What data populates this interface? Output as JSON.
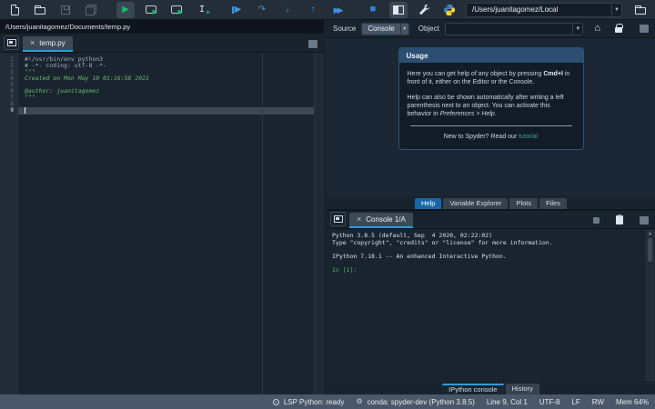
{
  "colors": {
    "accent_blue": "#2e9ce1",
    "selected_tab_blue": "#1767a8",
    "run_green": "#13bf67",
    "debug_blue": "#3f93de",
    "string_green": "#69bd6b",
    "link_teal": "#36a28c",
    "statusbar_bg": "#4b5769"
  },
  "icons": {
    "run": "▶",
    "run_cell": "▶",
    "run_selection_play": "▶",
    "ibeam": "I",
    "debug_file": "▶",
    "step_over": "↷",
    "step_into": "↓",
    "step_out": "↑",
    "continue": "▶▶",
    "stop": "■",
    "dropdown_arrow": "▼",
    "home": "⌂",
    "up_arrow": "↑",
    "close": "×",
    "gear": "⚙",
    "scroll_up": "▲"
  },
  "toolbar": {
    "working_dir_value": "/Users/juanitagomez/Local"
  },
  "editor": {
    "path": "/Users/juanitagomez/Documents/temp.py",
    "tab_label": "temp.py",
    "lines": [
      {
        "num": "1",
        "text": "#!/usr/bin/env python3"
      },
      {
        "num": "2",
        "text": "# -*- coding: utf-8 -*-"
      },
      {
        "num": "3",
        "text": "\"\"\""
      },
      {
        "num": "4",
        "text": "Created on Mon May 10 01:16:58 2021"
      },
      {
        "num": "5",
        "text": ""
      },
      {
        "num": "6",
        "text": "@author: juanitagomez"
      },
      {
        "num": "7",
        "text": "\"\"\""
      },
      {
        "num": "8",
        "text": ""
      },
      {
        "num": "9",
        "text": ""
      }
    ]
  },
  "help": {
    "source_label": "Source",
    "source_value": "Console",
    "object_label": "Object",
    "object_value": "",
    "usage_title": "Usage",
    "p1_pre": "Here you can get help of any object by pressing ",
    "p1_kbd": "Cmd+I",
    "p1_post": " in front of it, either on the Editor or the Console.",
    "p2_pre": "Help can also be shown automatically after writing a left parenthesis next to an object. You can activate this behavior in ",
    "p2_em": "Preferences > Help",
    "p2_post": ".",
    "footer_pre": "New to Spyder? Read our ",
    "footer_link": "tutorial",
    "tabs": [
      "Help",
      "Variable Explorer",
      "Plots",
      "Files"
    ],
    "active_tab": "Help"
  },
  "console": {
    "tab_label": "Console 1/A",
    "lines": [
      "Python 3.8.5 (default, Sep  4 2020, 02:22:02)",
      "Type \"copyright\", \"credits\" or \"license\" for more information.",
      "",
      "IPython 7.18.1 -- An enhanced Interactive Python.",
      ""
    ],
    "prompt": "In [1]:",
    "tabs": [
      "IPython console",
      "History"
    ],
    "active_tab": "IPython console"
  },
  "statusbar": {
    "lsp": "LSP Python: ready",
    "conda": "conda: spyder-dev (Python 3.8.5)",
    "cursor_pos": "Line 9, Col 1",
    "encoding": "UTF-8",
    "eol": "LF",
    "permissions": "RW",
    "memory": "Mem 64%"
  }
}
